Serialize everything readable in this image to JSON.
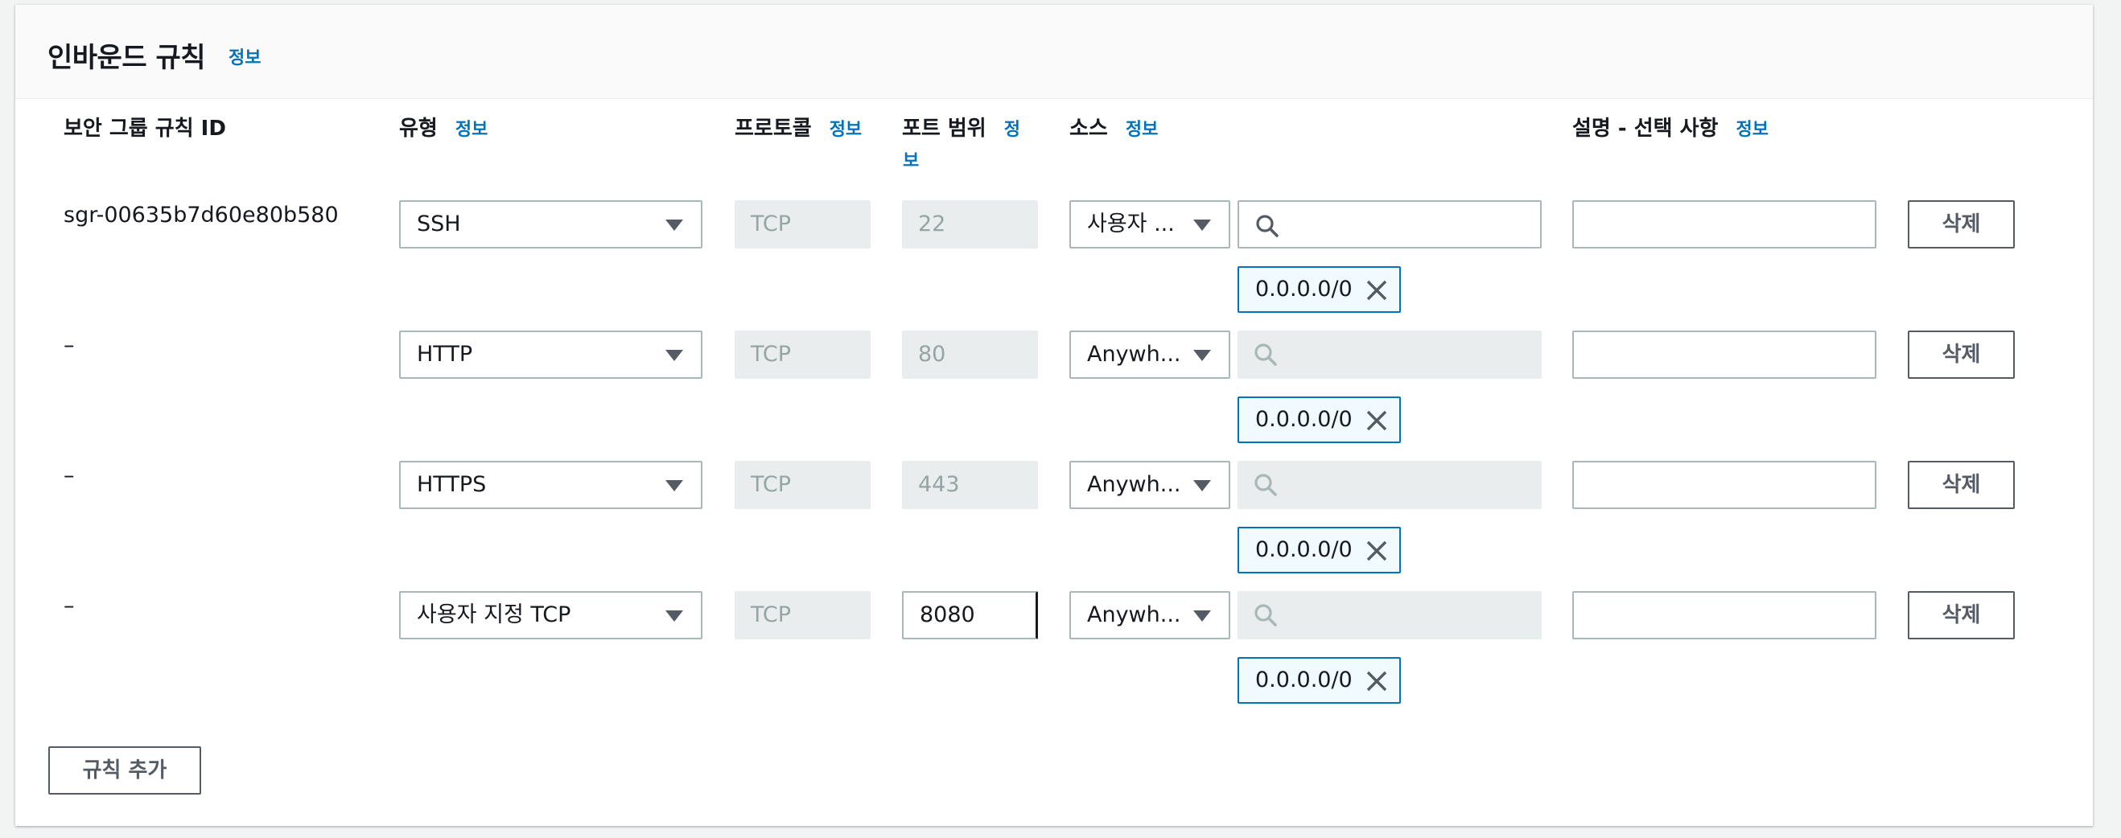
{
  "panel": {
    "title": "인바운드 규칙",
    "info": "정보"
  },
  "columns": {
    "rule_id": "보안 그룹 규칙 ID",
    "type": "유형",
    "protocol": "프로토콜",
    "port_range": "포트 범위",
    "source": "소스",
    "description": "설명 - 선택 사항",
    "info": "정보",
    "port_info_line1": "정",
    "port_info_line2": "보"
  },
  "rules": [
    {
      "id": "sgr-00635b7d60e80b580",
      "type": "SSH",
      "protocol": "TCP",
      "port": "22",
      "port_editable": false,
      "source": "사용자 ...",
      "source_search_enabled": true,
      "cidr": "0.0.0.0/0",
      "description": "",
      "delete": "삭제"
    },
    {
      "id": "–",
      "type": "HTTP",
      "protocol": "TCP",
      "port": "80",
      "port_editable": false,
      "source": "Anywh...",
      "source_search_enabled": false,
      "cidr": "0.0.0.0/0",
      "description": "",
      "delete": "삭제"
    },
    {
      "id": "–",
      "type": "HTTPS",
      "protocol": "TCP",
      "port": "443",
      "port_editable": false,
      "source": "Anywh...",
      "source_search_enabled": false,
      "cidr": "0.0.0.0/0",
      "description": "",
      "delete": "삭제"
    },
    {
      "id": "–",
      "type": "사용자 지정 TCP",
      "protocol": "TCP",
      "port": "8080",
      "port_editable": true,
      "source": "Anywh...",
      "source_search_enabled": false,
      "cidr": "0.0.0.0/0",
      "description": "",
      "delete": "삭제"
    }
  ],
  "add_rule": "규칙 추가",
  "icons": {
    "caret": "caret-down-icon",
    "search": "search-icon",
    "remove": "close-icon"
  },
  "colors": {
    "accent": "#0073bb",
    "token_bg": "#f1faff",
    "disabled_bg": "#eaeded"
  }
}
